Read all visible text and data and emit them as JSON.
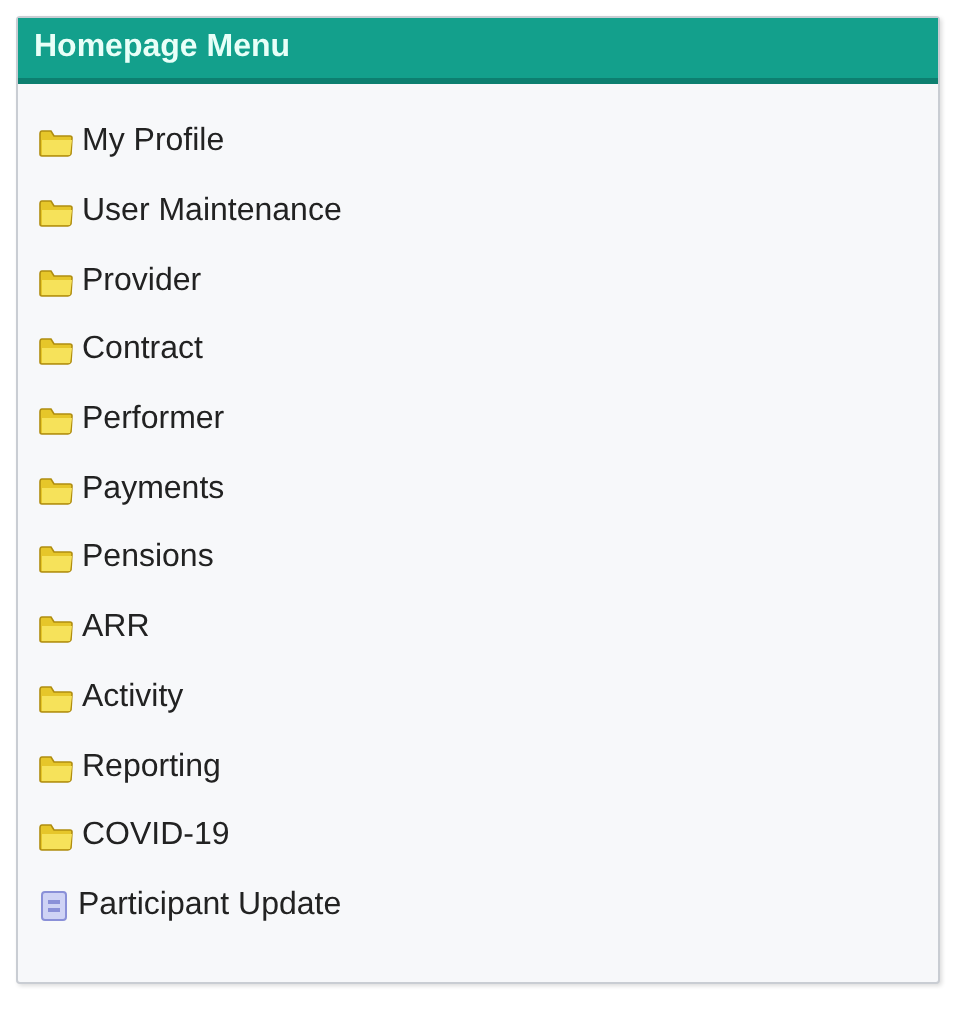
{
  "panel": {
    "title": "Homepage Menu"
  },
  "items": [
    {
      "label": "My Profile",
      "kind": "folder"
    },
    {
      "label": "User Maintenance",
      "kind": "folder"
    },
    {
      "label": "Provider",
      "kind": "folder"
    },
    {
      "label": "Contract",
      "kind": "folder"
    },
    {
      "label": "Performer",
      "kind": "folder"
    },
    {
      "label": "Payments",
      "kind": "folder"
    },
    {
      "label": "Pensions",
      "kind": "folder"
    },
    {
      "label": "ARR",
      "kind": "folder"
    },
    {
      "label": "Activity",
      "kind": "folder"
    },
    {
      "label": "Reporting",
      "kind": "folder"
    },
    {
      "label": "COVID-19",
      "kind": "folder"
    },
    {
      "label": "Participant Update",
      "kind": "document"
    }
  ]
}
